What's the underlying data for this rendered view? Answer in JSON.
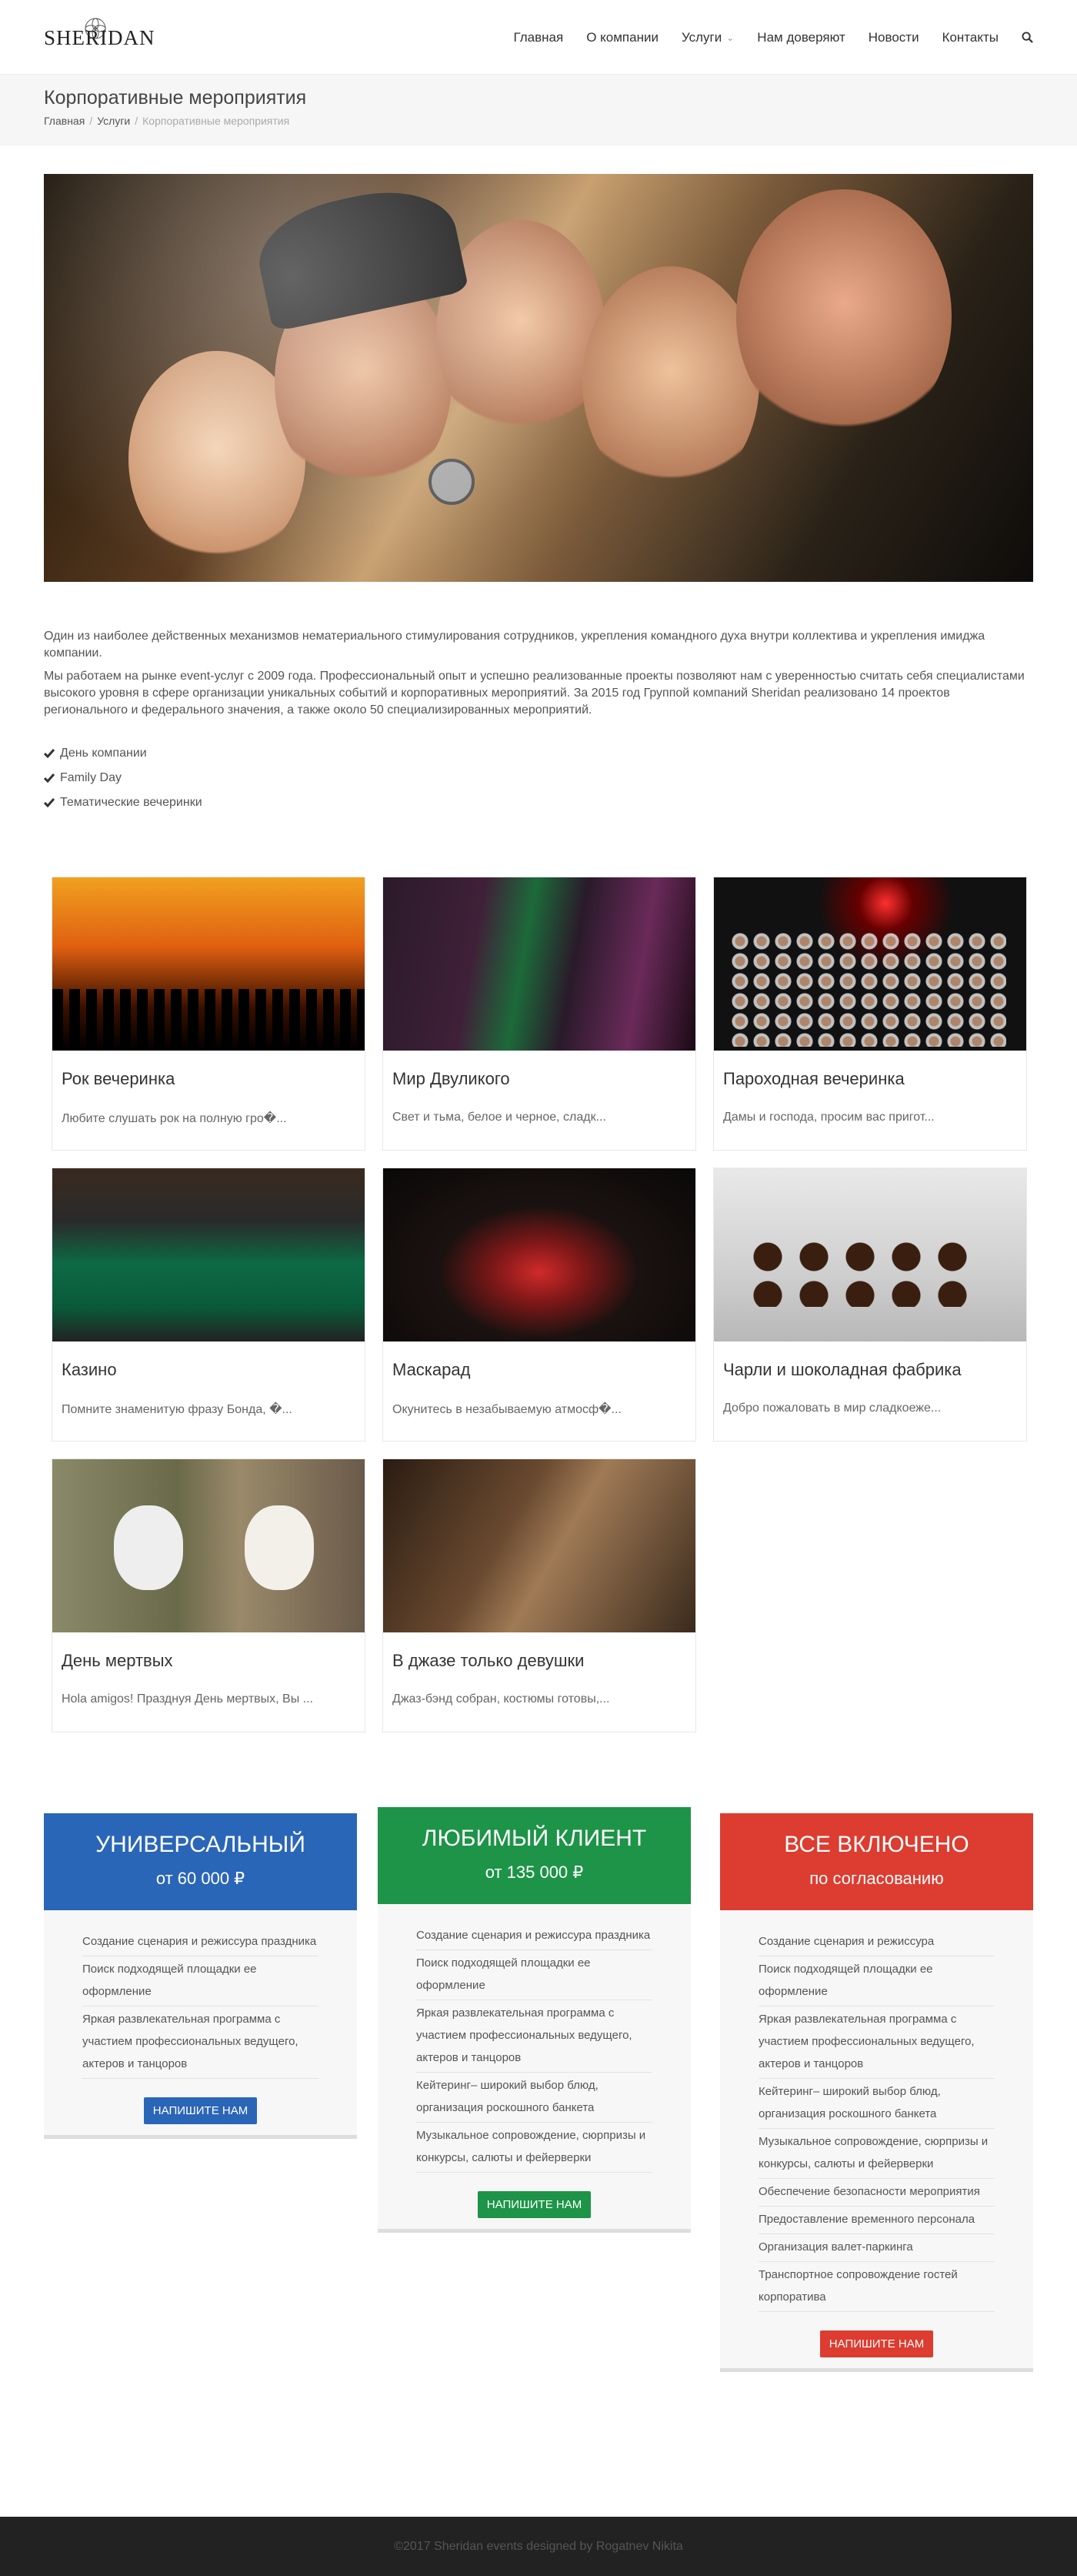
{
  "brand": {
    "logo_text": "SHERIDAN"
  },
  "nav": {
    "items": [
      "Главная",
      "О компании",
      "Услуги",
      "Нам доверяют",
      "Новости",
      "Контакты"
    ]
  },
  "page": {
    "title": "Корпоративные мероприятия",
    "crumbs": [
      "Главная",
      "Услуги",
      "Корпоративные мероприятия"
    ]
  },
  "intro": {
    "p1": "Один из наиболее действенных механизмов нематериального стимулирования сотрудников, укрепления командного духа внутри коллектива и укрепления имиджа компании.",
    "p2": "Мы работаем на рынке event-услуг с 2009 года. Профессиональный опыт и успешно реализованные проекты позволяют нам с уверенностью считать себя специалистами высокого уровня в сфере организации уникальных событий и корпоративных мероприятий. За 2015 год Группой компаний Sheridan реализовано 14 проектов регионального и федерального значения, а также около 50 специализированных мероприятий.",
    "checks": [
      "День компании",
      "Family Day",
      "Тематические вечеринки"
    ]
  },
  "cards": [
    {
      "title": "Рок вечеринка",
      "text": "Любите слушать рок на полную гро�..."
    },
    {
      "title": "Мир Двуликого",
      "text": "Свет и тьма, белое и черное, сладк..."
    },
    {
      "title": "Пароходная вечеринка",
      "text": "Дамы и господа, просим вас пригот..."
    },
    {
      "title": "Казино",
      "text": "Помните знаменитую фразу Бонда, �..."
    },
    {
      "title": "Маскарад",
      "text": "Окунитесь в незабываемую атмосф�..."
    },
    {
      "title": "Чарли и шоколадная фабрика",
      "text": "Добро пожаловать в мир сладкоеже..."
    },
    {
      "title": "День мертвых",
      "text": "Hola amigos! Празднуя День мертвых, Вы ..."
    },
    {
      "title": "В джазе только девушки",
      "text": "Джаз-бэнд собран, костюмы готовы,..."
    }
  ],
  "plans": [
    {
      "name": "УНИВЕРСАЛЬНЫЙ",
      "price": "от 60 000 ₽",
      "color": "#2a66b8",
      "features": [
        "Создание сценария и режиссура праздника",
        "Поиск подходящей площадки ее оформление",
        "Яркая развлекательная программа с участием профессиональных ведущего, актеров и танцоров"
      ],
      "button": "Напишите нам"
    },
    {
      "name": "ЛЮБИМЫЙ КЛИЕНТ",
      "price": "от 135 000 ₽",
      "color": "#1d9447",
      "features": [
        "Создание сценария и режиссура праздника",
        "Поиск подходящей площадки ее оформление",
        "Яркая развлекательная программа с участием профессиональных ведущего, актеров и танцоров",
        "Кейтеринг– широкий выбор блюд, организация роскошного банкета",
        "Музыкальное сопровождение, сюрпризы и конкурсы, салюты и фейерверки"
      ],
      "button": "Напишите нам"
    },
    {
      "name": "ВСЕ ВКЛЮЧЕНО",
      "price": "по согласованию",
      "color": "#dd3c30",
      "features": [
        "Создание сценария и режиссура",
        "Поиск подходящей площадки ее оформление",
        "Яркая развлекательная программа с участием профессиональных ведущего, актеров и танцоров",
        "Кейтеринг– широкий выбор блюд, организация роскошного банкета",
        "Музыкальное сопровождение, сюрпризы и конкурсы, салюты и фейерверки",
        "Обеспечение безопасности мероприятия",
        "Предоставление временного персонала",
        "Организация валет-паркинга",
        "Транспортное сопровождение гостей корпоратива"
      ],
      "button": "Напишите нам"
    }
  ],
  "footer": {
    "text": "©2017 Sheridan events designed by Rogatnev Nikita"
  }
}
